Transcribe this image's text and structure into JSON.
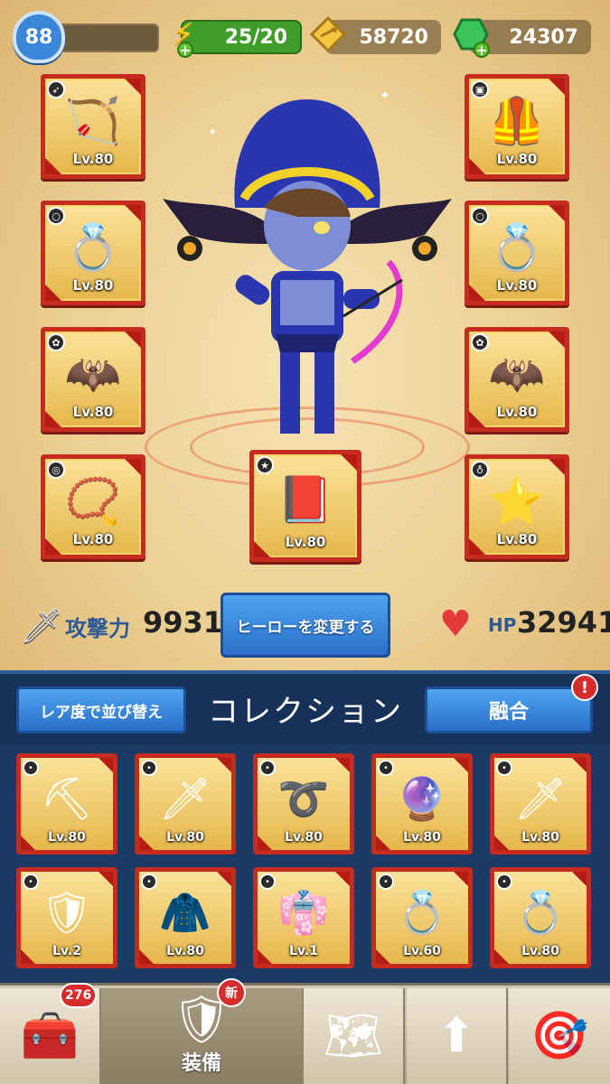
{
  "player": {
    "level": "88"
  },
  "resources": {
    "energy": "25/20",
    "gold": "58720",
    "gems": "24307"
  },
  "equipped": {
    "left": [
      {
        "icon": "🏹",
        "type": "bow",
        "level": "Lv.80"
      },
      {
        "icon": "💍",
        "type": "ring",
        "level": "Lv.80"
      },
      {
        "icon": "🦇",
        "type": "pet",
        "level": "Lv.80"
      },
      {
        "icon": "📿",
        "type": "bracelet",
        "level": "Lv.80"
      }
    ],
    "center": {
      "icon": "📕",
      "type": "book",
      "level": "Lv.80"
    },
    "right": [
      {
        "icon": "🦺",
        "type": "armor",
        "level": "Lv.80"
      },
      {
        "icon": "💍",
        "type": "ring",
        "level": "Lv.80"
      },
      {
        "icon": "🦇",
        "type": "pet",
        "level": "Lv.80"
      },
      {
        "icon": "⭐",
        "type": "amulet",
        "level": "Lv.80"
      }
    ]
  },
  "stats": {
    "attack_label": "攻撃力",
    "attack_value": "9931",
    "change_hero": "ヒーローを変更する",
    "hp_label": "HP",
    "hp_value": "32941"
  },
  "collection": {
    "sort_label": "レア度で並び替え",
    "title": "コレクション",
    "merge_label": "融合",
    "alert": "!",
    "items": [
      {
        "icon": "⛏",
        "level": "Lv.80"
      },
      {
        "icon": "🗡",
        "level": "Lv.80"
      },
      {
        "icon": "➰",
        "level": "Lv.80"
      },
      {
        "icon": "🔮",
        "level": "Lv.80"
      },
      {
        "icon": "🗡",
        "level": "Lv.80"
      },
      {
        "icon": "🛡",
        "level": "Lv.2"
      },
      {
        "icon": "🧥",
        "level": "Lv.80"
      },
      {
        "icon": "👘",
        "level": "Lv.1"
      },
      {
        "icon": "💍",
        "level": "Lv.60"
      },
      {
        "icon": "💍",
        "level": "Lv.80"
      }
    ]
  },
  "nav": {
    "chest_count": "276",
    "new_label": "新",
    "equip_label": "装備"
  }
}
